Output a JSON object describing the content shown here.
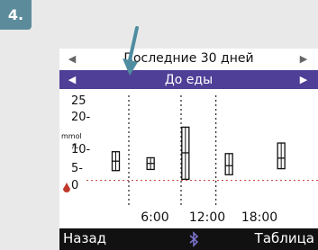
{
  "step": {
    "number": "4."
  },
  "header": {
    "period_label": "Последние 30 дней",
    "meal_label": "До еды"
  },
  "footer": {
    "back_label": "Назад",
    "table_label": "Таблица"
  },
  "colors": {
    "accent": "#4f3f96",
    "step_badge": "#5c8c9c",
    "pointer": "#4f8da0",
    "warning": "#c0392b"
  },
  "icons": {
    "prev": "triangle-left-icon",
    "next": "triangle-right-icon",
    "bluetooth": "bluetooth-icon",
    "pointer": "pointer-arrow-icon",
    "low_marker": "blood-drop-icon"
  },
  "chart_data": {
    "type": "box",
    "y_ticks": [
      "25",
      "20-",
      "15",
      "10-",
      "5-",
      "0"
    ],
    "y_unit": [
      "mmol",
      "/L"
    ],
    "x_ticks": [
      "6:00",
      "12:00",
      "18:00"
    ],
    "ylim": [
      0,
      25
    ],
    "xlim": [
      0,
      24
    ],
    "low_threshold": 3.9,
    "divider_hours": [
      3,
      9,
      13
    ],
    "boxes": [
      {
        "x": 1.5,
        "q1": 6.5,
        "median": 9.0,
        "q3": 11.5
      },
      {
        "x": 5.5,
        "q1": 6.8,
        "median": 8.4,
        "q3": 9.9
      },
      {
        "x": 9.5,
        "q1": 4.2,
        "median": 11.2,
        "q3": 18.0
      },
      {
        "x": 14.5,
        "q1": 5.4,
        "median": 7.8,
        "q3": 11.0
      },
      {
        "x": 20.5,
        "q1": 7.0,
        "median": 9.8,
        "q3": 13.8
      }
    ]
  }
}
